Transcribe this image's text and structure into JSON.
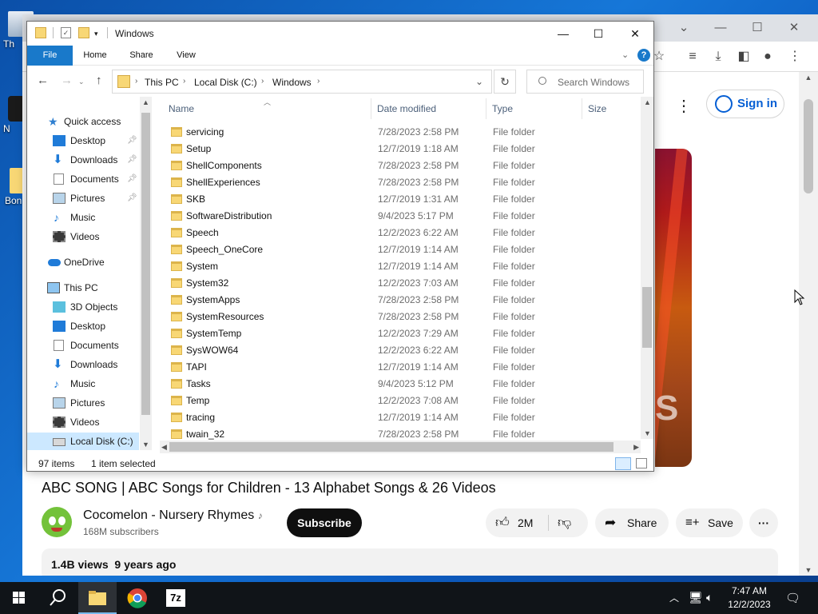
{
  "explorer": {
    "title": "Windows",
    "ribbon_tabs": [
      "File",
      "Home",
      "Share",
      "View"
    ],
    "breadcrumb": [
      "This PC",
      "Local Disk (C:)",
      "Windows"
    ],
    "search_placeholder": "Search Windows",
    "columns": [
      "Name",
      "Date modified",
      "Type",
      "Size"
    ],
    "nav": {
      "quick_access": "Quick access",
      "qa_items": [
        "Desktop",
        "Downloads",
        "Documents",
        "Pictures",
        "Music",
        "Videos"
      ],
      "onedrive": "OneDrive",
      "this_pc": "This PC",
      "pc_items": [
        "3D Objects",
        "Desktop",
        "Documents",
        "Downloads",
        "Music",
        "Pictures",
        "Videos",
        "Local Disk (C:)"
      ]
    },
    "files": [
      {
        "name": "servicing",
        "date": "7/28/2023 2:58 PM",
        "type": "File folder"
      },
      {
        "name": "Setup",
        "date": "12/7/2019 1:18 AM",
        "type": "File folder"
      },
      {
        "name": "ShellComponents",
        "date": "7/28/2023 2:58 PM",
        "type": "File folder"
      },
      {
        "name": "ShellExperiences",
        "date": "7/28/2023 2:58 PM",
        "type": "File folder"
      },
      {
        "name": "SKB",
        "date": "12/7/2019 1:31 AM",
        "type": "File folder"
      },
      {
        "name": "SoftwareDistribution",
        "date": "9/4/2023 5:17 PM",
        "type": "File folder"
      },
      {
        "name": "Speech",
        "date": "12/2/2023 6:22 AM",
        "type": "File folder"
      },
      {
        "name": "Speech_OneCore",
        "date": "12/7/2019 1:14 AM",
        "type": "File folder"
      },
      {
        "name": "System",
        "date": "12/7/2019 1:14 AM",
        "type": "File folder"
      },
      {
        "name": "System32",
        "date": "12/2/2023 7:03 AM",
        "type": "File folder"
      },
      {
        "name": "SystemApps",
        "date": "7/28/2023 2:58 PM",
        "type": "File folder"
      },
      {
        "name": "SystemResources",
        "date": "7/28/2023 2:58 PM",
        "type": "File folder"
      },
      {
        "name": "SystemTemp",
        "date": "12/2/2023 7:29 AM",
        "type": "File folder"
      },
      {
        "name": "SysWOW64",
        "date": "12/2/2023 6:22 AM",
        "type": "File folder"
      },
      {
        "name": "TAPI",
        "date": "12/7/2019 1:14 AM",
        "type": "File folder"
      },
      {
        "name": "Tasks",
        "date": "9/4/2023 5:12 PM",
        "type": "File folder"
      },
      {
        "name": "Temp",
        "date": "12/2/2023 7:08 AM",
        "type": "File folder"
      },
      {
        "name": "tracing",
        "date": "12/7/2019 1:14 AM",
        "type": "File folder"
      },
      {
        "name": "twain_32",
        "date": "7/28/2023 2:58 PM",
        "type": "File folder"
      }
    ],
    "status_count": "97 items",
    "status_selected": "1 item selected"
  },
  "youtube": {
    "sign_in": "Sign in",
    "video_title": "ABC SONG | ABC Songs for Children - 13 Alphabet Songs & 26 Videos",
    "channel_name": "Cocomelon - Nursery Rhymes",
    "subscribers": "168M subscribers",
    "subscribe": "Subscribe",
    "likes": "2M",
    "share": "Share",
    "save": "Save",
    "views": "1.4B views",
    "age": "9 years ago"
  },
  "desktop": {
    "icons": [
      "Th",
      "N",
      "Bon"
    ]
  },
  "taskbar": {
    "time": "7:47 AM",
    "date": "12/2/2023",
    "sevenzip": "7z"
  }
}
